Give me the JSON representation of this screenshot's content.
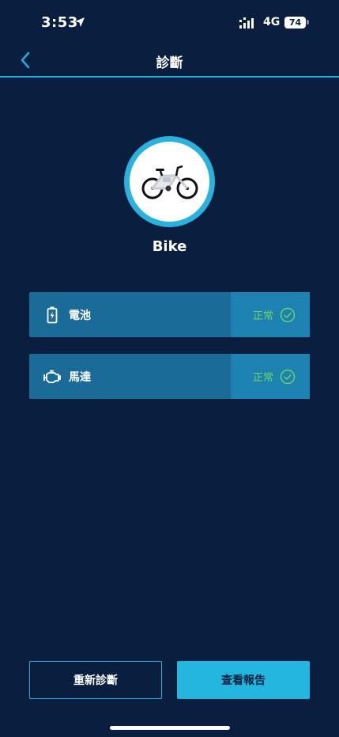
{
  "status_bar": {
    "time": "3:53",
    "network": "4G",
    "battery_level": "74"
  },
  "nav": {
    "title": "診斷"
  },
  "device": {
    "name": "Bike",
    "icon": "bike-icon"
  },
  "diagnostics": [
    {
      "label": "電池",
      "icon": "battery-charging-icon",
      "status": "正常"
    },
    {
      "label": "馬達",
      "icon": "motor-icon",
      "status": "正常"
    }
  ],
  "actions": {
    "rediagnose_label": "重新診斷",
    "view_report_label": "查看報告"
  },
  "colors": {
    "background": "#0a1f3f",
    "accent": "#23b7df",
    "row": "#1a6b97",
    "ok": "#6fd36a"
  }
}
